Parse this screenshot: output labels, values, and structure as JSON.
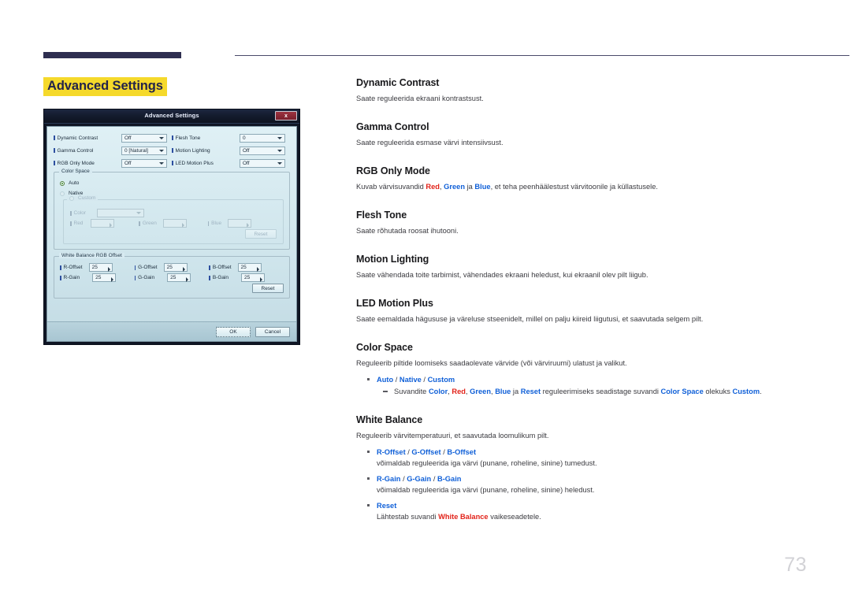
{
  "page": {
    "title": "Advanced Settings",
    "number": "73"
  },
  "dialog": {
    "title": "Advanced Settings",
    "close_label": "x",
    "fields": [
      {
        "label": "Dynamic Contrast",
        "value": "Off"
      },
      {
        "label": "Flesh Tone",
        "value": "0"
      },
      {
        "label": "Gamma Control",
        "value": "0 [Natural]"
      },
      {
        "label": "Motion Lighting",
        "value": "Off"
      },
      {
        "label": "RGB Only Mode",
        "value": "Off"
      },
      {
        "label": "LED Motion Plus",
        "value": "Off"
      }
    ],
    "color_space": {
      "legend": "Color Space",
      "options": [
        {
          "label": "Auto",
          "selected": true
        },
        {
          "label": "Native",
          "selected": false
        },
        {
          "label": "Custom",
          "selected": false
        }
      ],
      "custom": {
        "color_label": "Color",
        "color_value": "",
        "red_label": "Red",
        "red_value": "",
        "green_label": "Green",
        "green_value": "",
        "blue_label": "Blue",
        "blue_value": "",
        "reset_label": "Reset"
      }
    },
    "white_balance": {
      "legend": "White Balance RGB Offset",
      "rows": [
        {
          "r_label": "R-Offset",
          "r_value": "25",
          "g_label": "G-Offset",
          "g_value": "25",
          "b_label": "B-Offset",
          "b_value": "25"
        },
        {
          "r_label": "R-Gain",
          "r_value": "25",
          "g_label": "G-Gain",
          "g_value": "25",
          "b_label": "B-Gain",
          "b_value": "25"
        }
      ],
      "reset_label": "Reset"
    },
    "footer": {
      "ok_label": "OK",
      "cancel_label": "Cancel"
    }
  },
  "sections": {
    "dynamic_contrast": {
      "heading": "Dynamic Contrast",
      "body": "Saate reguleerida ekraani kontrastsust."
    },
    "gamma_control": {
      "heading": "Gamma Control",
      "body": "Saate reguleerida esmase värvi intensiivsust."
    },
    "rgb_only_mode": {
      "heading": "RGB Only Mode",
      "body_1": "Kuvab värvisuvandid ",
      "red": "Red",
      "body_2": ", ",
      "green": "Green",
      "body_3": " ja ",
      "blue": "Blue",
      "body_4": ", et teha peenhäälestust värvitoonile ja küllastusele."
    },
    "flesh_tone": {
      "heading": "Flesh Tone",
      "body": "Saate rõhutada roosat ihutooni."
    },
    "motion_lighting": {
      "heading": "Motion Lighting",
      "body": "Saate vähendada toite tarbimist, vähendades ekraani heledust, kui ekraanil olev pilt liigub."
    },
    "led_motion_plus": {
      "heading": "LED Motion Plus",
      "body": "Saate eemaldada hägususe ja väreluse stseenidelt, millel on palju kiireid liigutusi, et saavutada selgem pilt."
    },
    "color_space": {
      "heading": "Color Space",
      "body": "Reguleerib piltide loomiseks saadaolevate värvide (või värviruumi) ulatust ja valikut.",
      "bullet": {
        "auto": "Auto",
        "native": "Native",
        "custom": "Custom",
        "sep": " / "
      },
      "sub": {
        "t1": "Suvandite ",
        "color": "Color",
        "t2": ", ",
        "red": "Red",
        "t3": ", ",
        "green": "Green",
        "t4": ", ",
        "blue": "Blue",
        "t5": " ja ",
        "reset": "Reset",
        "t6": " reguleerimiseks seadistage suvandi ",
        "color_space": "Color Space",
        "t7": " olekuks ",
        "custom": "Custom",
        "t8": "."
      }
    },
    "white_balance": {
      "heading": "White Balance",
      "body": "Reguleerib värvitemperatuuri, et saavutada loomulikum pilt.",
      "bullets": [
        {
          "p1": "R-Offset",
          "p2": "G-Offset",
          "p3": "B-Offset",
          "desc": "võimaldab reguleerida iga värvi (punane, roheline, sinine) tumedust."
        },
        {
          "p1": "R-Gain",
          "p2": "G-Gain",
          "p3": "B-Gain",
          "desc": "võimaldab reguleerida iga värvi (punane, roheline, sinine) heledust."
        }
      ],
      "reset_bullet": {
        "label": "Reset",
        "d1": "Lähtestab suvandi ",
        "wb": "White Balance",
        "d2": " vaikeseadetele."
      }
    }
  }
}
